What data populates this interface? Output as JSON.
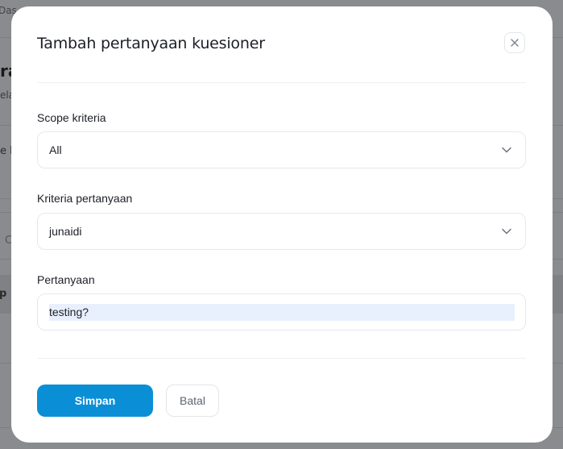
{
  "background": {
    "fragments": [
      "Das",
      "ra",
      "ela",
      "e k",
      "C",
      "p"
    ]
  },
  "modal": {
    "title": "Tambah pertanyaan kuesioner",
    "close_icon": "close-icon",
    "fields": {
      "scope": {
        "label": "Scope kriteria",
        "value": "All"
      },
      "criteria": {
        "label": "Kriteria pertanyaan",
        "value": "junaidi"
      },
      "question": {
        "label": "Pertanyaan",
        "value": "testing?"
      }
    },
    "buttons": {
      "save_label": "Simpan",
      "cancel_label": "Batal"
    }
  },
  "colors": {
    "primary": "#0a8fd6",
    "overlay": "#8a8b8e",
    "autofill": "#e8f0fe"
  }
}
